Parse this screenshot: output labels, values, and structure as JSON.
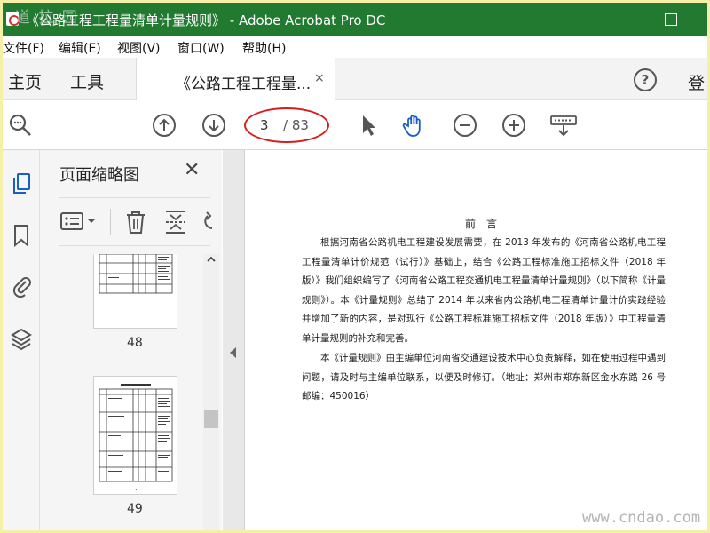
{
  "window": {
    "title": "《公路工程工程量清单计量规则》 - Adobe Acrobat Pro DC",
    "watermark": "道 拉 园"
  },
  "menu": [
    "文件(F)",
    "编辑(E)",
    "视图(V)",
    "窗口(W)",
    "帮助(H)"
  ],
  "tabs": {
    "home": "主页",
    "tools": "工具",
    "document": "《公路工程工程量...",
    "close": "×",
    "help": "?",
    "signin": "登"
  },
  "toolbar": {
    "current_page": "3",
    "total_pages": "/ 83"
  },
  "thumbnails": {
    "title": "页面缩略图",
    "close": "✕",
    "pages": [
      {
        "number": "48",
        "dot": "."
      },
      {
        "number": "49",
        "dot": "."
      }
    ]
  },
  "document": {
    "heading": "前言",
    "paragraph1": "根据河南省公路机电工程建设发展需要，在 2013 年发布的《河南省公路机电工程工程量清单计价规范（试行）》基础上，结合《公路工程标准施工招标文件（2018 年版）》我们组织编写了《河南省公路工程交通机电工程量清单计量规则》（以下简称《计量规则》）。本《计量规则》总结了 2014 年以来省内公路机电工程清单计量计价实践经验并增加了新的内容，是对现行《公路工程标准施工招标文件（2018 年版）》中工程量清单计量规则的补充和完善。",
    "paragraph2": "本《计量规则》由主编单位河南省交通建设技术中心负责解释，如在使用过程中遇到问题，请及时与主编单位联系，以便及时修订。（地址：郑州市郑东新区金水东路 26 号 邮编：450016）"
  },
  "site_watermark": "www.cndao.com",
  "colors": {
    "titlebar": "#217a2f",
    "highlight_oval": "#d61c1c",
    "frame": "#f4f0a8"
  }
}
